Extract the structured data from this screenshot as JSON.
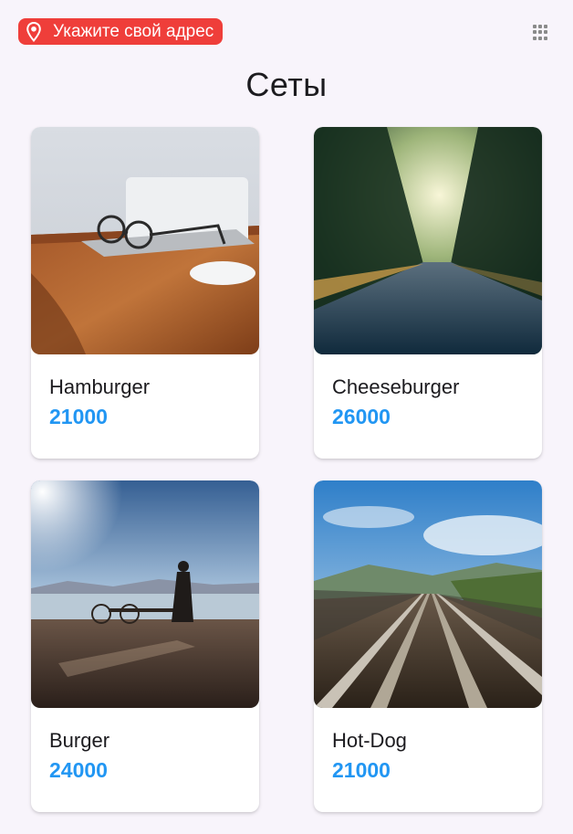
{
  "header": {
    "address_prompt": "Укажите свой адрес",
    "address_icon": "location-pin-icon",
    "menu_icon": "grid-menu-icon",
    "accent_color": "#ef3e3a"
  },
  "page": {
    "title": "Сеты"
  },
  "products": [
    {
      "name": "Hamburger",
      "price": "21000"
    },
    {
      "name": "Cheeseburger",
      "price": "26000"
    },
    {
      "name": "Burger",
      "price": "24000"
    },
    {
      "name": "Hot-Dog",
      "price": "21000"
    }
  ],
  "colors": {
    "price": "#2196f3",
    "background": "#f8f4fb"
  }
}
